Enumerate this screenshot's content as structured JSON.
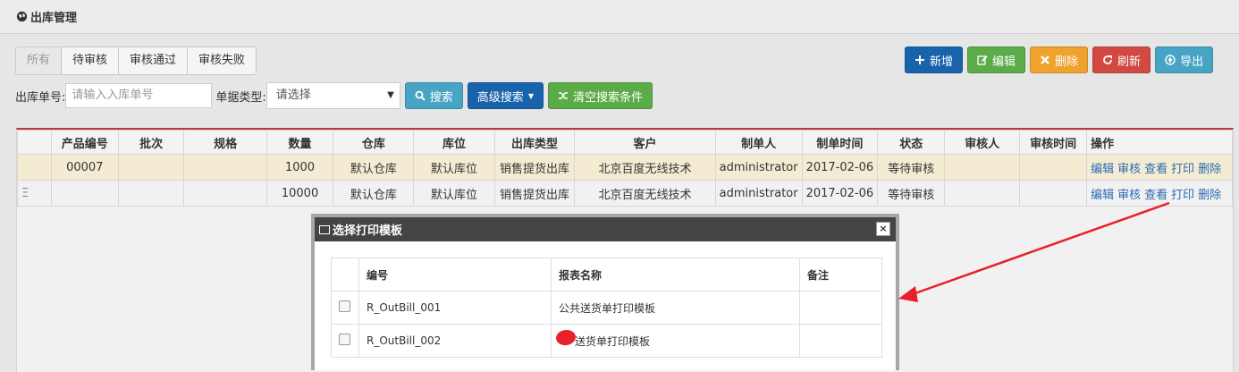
{
  "page": {
    "title": "出库管理"
  },
  "status_tabs": [
    {
      "label": "所有",
      "active": true
    },
    {
      "label": "待审核",
      "active": false
    },
    {
      "label": "审核通过",
      "active": false
    },
    {
      "label": "审核失败",
      "active": false
    }
  ],
  "toolbar": {
    "add": "新增",
    "edit": "编辑",
    "delete": "删除",
    "refresh": "刷新",
    "export": "导出"
  },
  "search": {
    "order_no_label": "出库单号:",
    "order_no_placeholder": "请输入入库单号",
    "type_label": "单据类型:",
    "type_value": "请选择",
    "search_btn": "搜索",
    "advanced_btn": "高级搜索",
    "clear_btn": "清空搜索条件"
  },
  "table": {
    "columns": [
      "",
      "产品编号",
      "批次",
      "规格",
      "数量",
      "仓库",
      "库位",
      "出库类型",
      "客户",
      "制单人",
      "制单时间",
      "状态",
      "审核人",
      "审核时间",
      "操作"
    ],
    "rows": [
      {
        "c0": "",
        "product_no": "00007",
        "batch": "",
        "spec": "",
        "qty": "1000",
        "warehouse": "默认仓库",
        "location": "默认库位",
        "out_type": "销售提货出库",
        "customer": "北京百度无线技术",
        "creator": "administrator",
        "created": "2017-02-06",
        "status": "等待审核",
        "auditor": "",
        "audit_time": ""
      },
      {
        "c0": "Ξ",
        "product_no": "",
        "batch": "",
        "spec": "",
        "qty": "10000",
        "warehouse": "默认仓库",
        "location": "默认库位",
        "out_type": "销售提货出库",
        "customer": "北京百度无线技术",
        "creator": "administrator",
        "created": "2017-02-06",
        "status": "等待审核",
        "auditor": "",
        "audit_time": ""
      }
    ],
    "actions": [
      "编辑",
      "审核",
      "查看",
      "打印",
      "删除"
    ]
  },
  "modal": {
    "title": "选择打印模板",
    "close": "×",
    "headers": [
      "",
      "编号",
      "报表名称",
      "备注"
    ],
    "rows": [
      {
        "code": "R_OutBill_001",
        "name": "公共送货单打印模板",
        "note": ""
      },
      {
        "code": "R_OutBill_002",
        "name": "送货单打印模板",
        "note": ""
      }
    ]
  },
  "colors": {
    "primary": "#1963ad",
    "success": "#5cab49",
    "warning": "#efa22e",
    "danger": "#d24942",
    "info": "#47a4c4",
    "annotation": "#e8202a"
  }
}
